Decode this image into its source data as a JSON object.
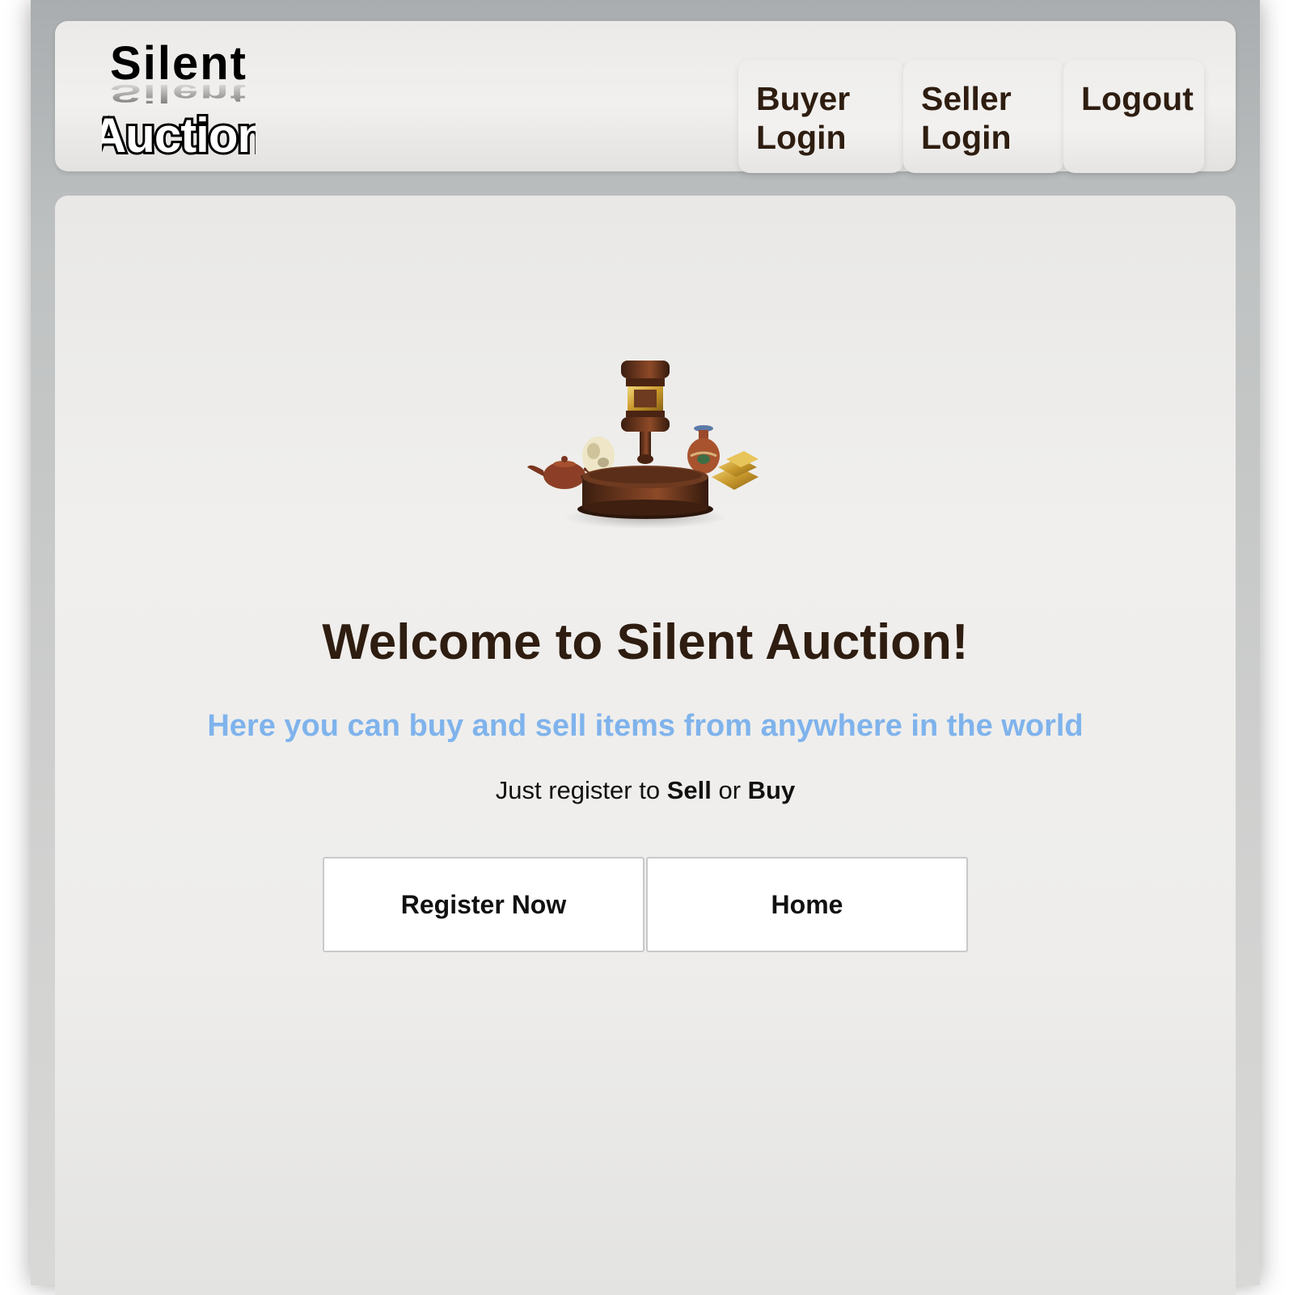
{
  "header": {
    "logo": {
      "line1": "Silent",
      "line2": "Auction"
    },
    "nav": {
      "buyer_line1": "Buyer",
      "buyer_line2": "Login",
      "seller_line1": "Seller",
      "seller_line2": "Login",
      "logout": "Logout"
    }
  },
  "main": {
    "hero_image": "auction-gavel-with-antiques",
    "welcome": "Welcome to Silent Auction!",
    "tagline": "Here you can buy and sell items from anywhere in the world",
    "subline": {
      "prefix": "Just register to ",
      "sell": "Sell",
      "or": " or ",
      "buy": "Buy"
    },
    "buttons": {
      "register": "Register Now",
      "home": "Home"
    }
  },
  "colors": {
    "heading_brown": "#2e1d10",
    "tagline_blue": "#7fb3ec",
    "frame_gray": "#a9adaf",
    "panel_bg": "#efeeec"
  }
}
